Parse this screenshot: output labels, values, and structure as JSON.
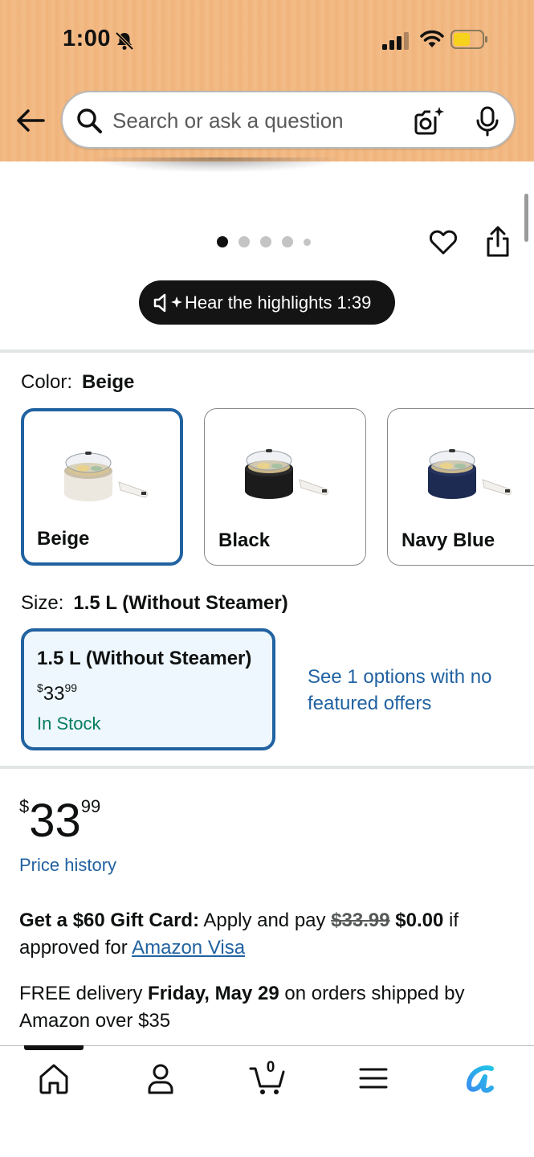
{
  "status_bar": {
    "time": "1:00"
  },
  "search": {
    "placeholder": "Search or ask a question"
  },
  "gallery": {
    "dot_count": 5,
    "active_index": 0
  },
  "highlights": {
    "label": "Hear the highlights 1:39"
  },
  "color": {
    "label": "Color:",
    "selected": "Beige",
    "options": [
      {
        "name": "Beige",
        "body_color": "#ece7df"
      },
      {
        "name": "Black",
        "body_color": "#1b1b1b"
      },
      {
        "name": "Navy Blue",
        "body_color": "#1d2a52"
      }
    ]
  },
  "size": {
    "label": "Size:",
    "selected": "1.5 L (Without Steamer)",
    "card": {
      "name": "1.5 L (Without Steamer)",
      "price_symbol": "$",
      "price_whole": "33",
      "price_fraction": "99",
      "stock": "In Stock"
    },
    "see_options": "See 1 options with no featured offers"
  },
  "price": {
    "symbol": "$",
    "whole": "33",
    "fraction": "99",
    "history_link": "Price history"
  },
  "gift_card": {
    "bold_lead": "Get a $60 Gift Card:",
    "text": " Apply and pay ",
    "old_price": "$33.99",
    "new_price": "$0.00",
    "text_after": " if approved for ",
    "link": "Amazon Visa"
  },
  "delivery": {
    "prefix": "FREE delivery ",
    "date": "Friday, May 29",
    "suffix": " on orders shipped by Amazon over $35"
  },
  "bottom_nav": {
    "items": [
      "home-icon",
      "account-icon",
      "cart-icon",
      "menu-icon",
      "rufus-icon"
    ],
    "cart_count": "0"
  },
  "colors": {
    "accent": "#2162a1",
    "stock_green": "#067d62",
    "header_bg": "#f1b57e"
  }
}
